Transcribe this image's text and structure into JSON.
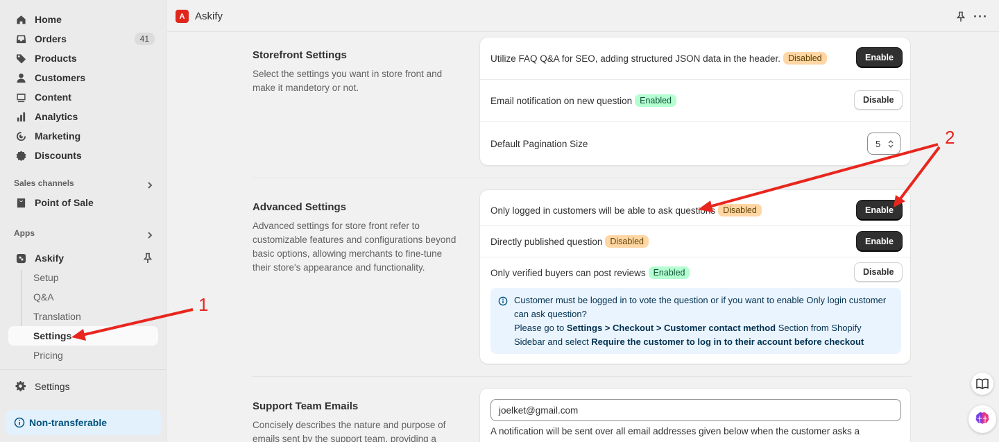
{
  "sidebar": {
    "items": [
      {
        "label": "Home",
        "icon": "home-icon"
      },
      {
        "label": "Orders",
        "icon": "inbox-icon",
        "badge": "41"
      },
      {
        "label": "Products",
        "icon": "tag-icon"
      },
      {
        "label": "Customers",
        "icon": "person-icon"
      },
      {
        "label": "Content",
        "icon": "image-icon"
      },
      {
        "label": "Analytics",
        "icon": "bar-chart-icon"
      },
      {
        "label": "Marketing",
        "icon": "target-icon"
      },
      {
        "label": "Discounts",
        "icon": "discount-icon"
      }
    ],
    "sales_channels_label": "Sales channels",
    "pos_label": "Point of Sale",
    "apps_label": "Apps",
    "app_name": "Askify",
    "app_sub_items": [
      "Setup",
      "Q&A",
      "Translation",
      "Settings",
      "Pricing"
    ],
    "active_sub_item": "Settings",
    "settings_label": "Settings",
    "non_transferable_label": "Non-transferable"
  },
  "topbar": {
    "app_title": "Askify",
    "logo_text": "A"
  },
  "storefront": {
    "title": "Storefront Settings",
    "description": "Select the settings you want in store front and make it mandetory or not.",
    "rows": [
      {
        "text": "Utilize FAQ Q&A for SEO, adding structured JSON data in the header.",
        "status": "Disabled",
        "button": "Enable"
      },
      {
        "text": "Email notification on new question",
        "status": "Enabled",
        "button": "Disable"
      },
      {
        "text": "Default Pagination Size",
        "value": "5"
      }
    ]
  },
  "advanced": {
    "title": "Advanced Settings",
    "description": "Advanced settings for store front refer to customizable features and configurations beyond basic options, allowing merchants to fine-tune their store's appearance and functionality.",
    "rows": [
      {
        "text": "Only logged in customers will be able to ask questions",
        "status": "Disabled",
        "button": "Enable"
      },
      {
        "text": "Directly published question",
        "status": "Disabled",
        "button": "Enable"
      },
      {
        "text": "Only verified buyers can post reviews",
        "status": "Enabled",
        "button": "Disable"
      }
    ],
    "info": {
      "line1": "Customer must be logged in to vote the question or if you want to enable Only login customer can ask question?",
      "please_go": "Please go to ",
      "path": "Settings > Checkout > Customer contact method",
      "mid": " Section from Shopify Sidebar and select ",
      "option": "Require the customer to log in to their account before checkout"
    }
  },
  "support": {
    "title": "Support Team Emails",
    "description": "Concisely describes the nature and purpose of emails sent by the support team, providing a",
    "email_value": "joelket@gmail.com",
    "note": "A notification will be sent over all email addresses given below when the customer asks a"
  },
  "annotations": {
    "label_1": "1",
    "label_2": "2",
    "color": "#e8261e"
  }
}
